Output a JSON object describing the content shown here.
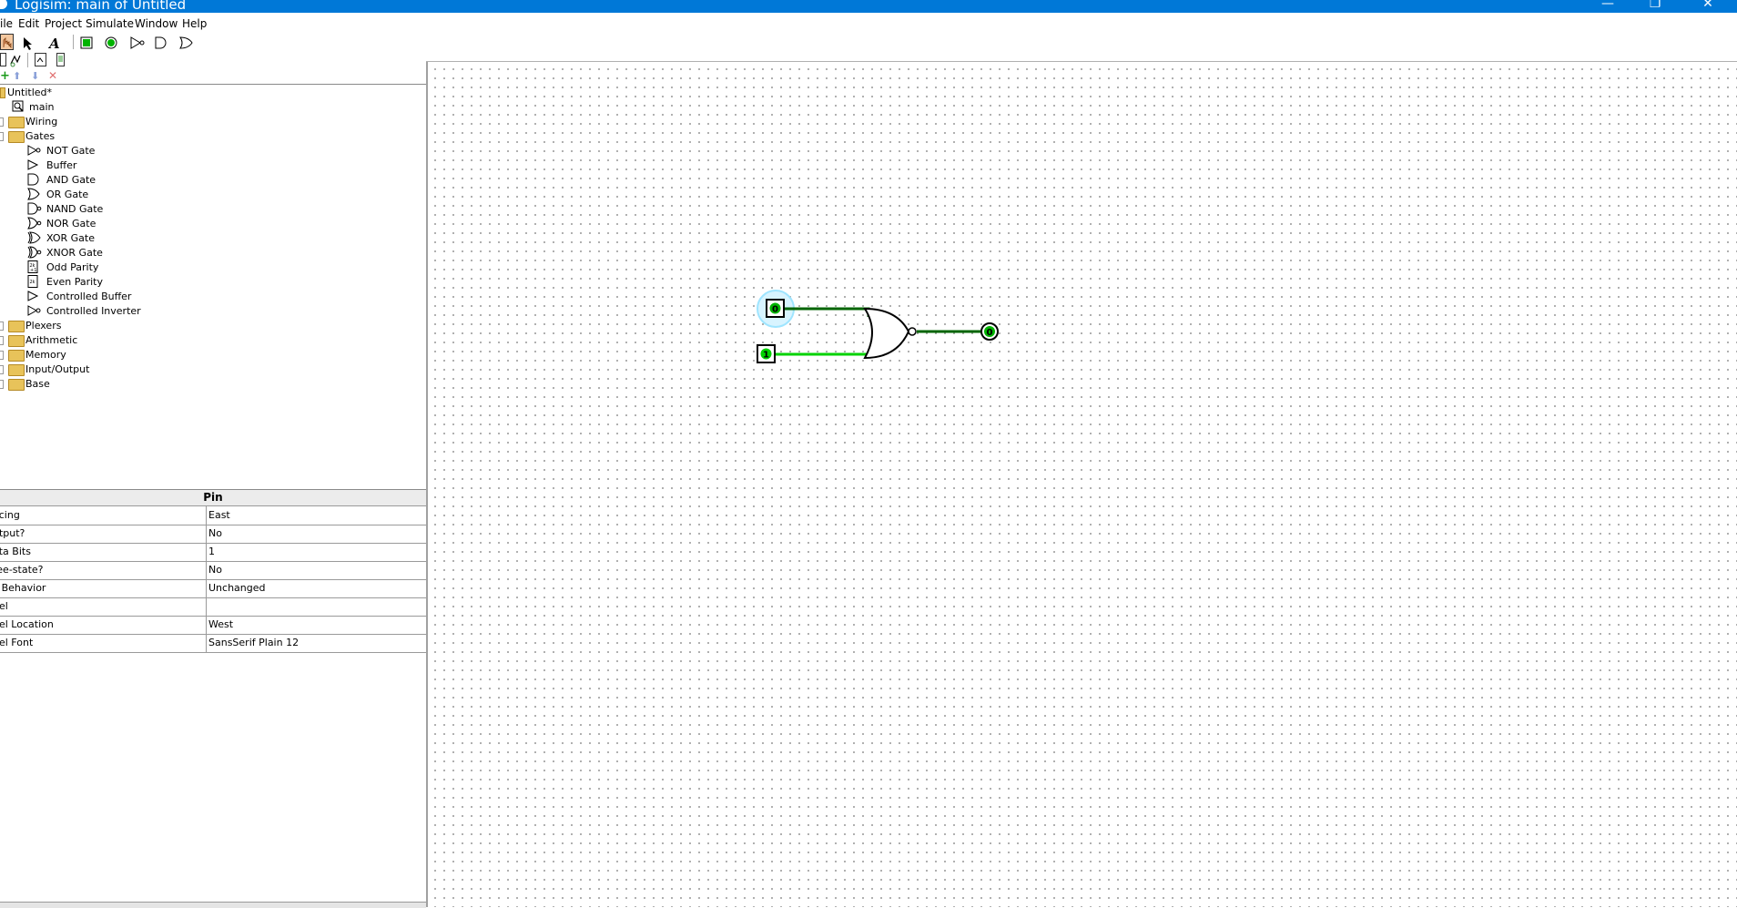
{
  "window": {
    "title": "Logisim: main of Untitled",
    "minimize": "—",
    "restore": "❐",
    "close": "✕"
  },
  "menu": [
    "ile",
    "Edit",
    "Project",
    "Simulate",
    "Window",
    "Help"
  ],
  "tree": {
    "root": "Untitled*",
    "circuit": "main",
    "folders": {
      "wiring": "Wiring",
      "gates": "Gates",
      "plexers": "Plexers",
      "arithmetic": "Arithmetic",
      "memory": "Memory",
      "io": "Input/Output",
      "base": "Base"
    },
    "gates": [
      "NOT Gate",
      "Buffer",
      "AND Gate",
      "OR Gate",
      "NAND Gate",
      "NOR Gate",
      "XOR Gate",
      "XNOR Gate",
      "Odd Parity",
      "Even Parity",
      "Controlled Buffer",
      "Controlled Inverter"
    ]
  },
  "attributes": {
    "title": "Pin",
    "rows": [
      {
        "name": "acing",
        "value": "East"
      },
      {
        "name": "utput?",
        "value": "No"
      },
      {
        "name": "ata Bits",
        "value": "1"
      },
      {
        "name": "ree-state?",
        "value": "No"
      },
      {
        "name": "ll Behavior",
        "value": "Unchanged"
      },
      {
        "name": "bel",
        "value": ""
      },
      {
        "name": "bel Location",
        "value": "West"
      },
      {
        "name": "bel Font",
        "value": "SansSerif Plain 12"
      }
    ]
  },
  "circuit": {
    "input_a_value": "0",
    "input_b_value": "1",
    "output_value": "0",
    "gate": "NOR Gate",
    "colors": {
      "wire_low": "#006400",
      "wire_high": "#00d200",
      "selection": "#9fe5ff"
    }
  }
}
